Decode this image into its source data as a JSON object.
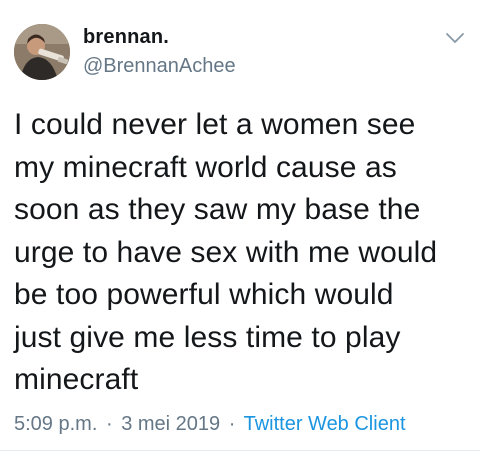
{
  "author": {
    "display_name": "brennan.",
    "handle": "@BrennanAchee",
    "avatar_icon": "user-photo-avatar"
  },
  "menu": {
    "icon": "chevron-down-icon"
  },
  "tweet": {
    "lines": [
      "I could never let a women see",
      "my minecraft world cause as",
      "soon as they saw my base the",
      "urge to have sex with me would",
      "be too powerful which would",
      "just give me less time to play",
      "minecraft"
    ]
  },
  "meta": {
    "time": "5:09 p.m.",
    "separator": "·",
    "date": "3 mei 2019",
    "client": "Twitter Web Client"
  },
  "colors": {
    "text": "#14171a",
    "muted": "#657786",
    "link": "#1b95e0"
  }
}
